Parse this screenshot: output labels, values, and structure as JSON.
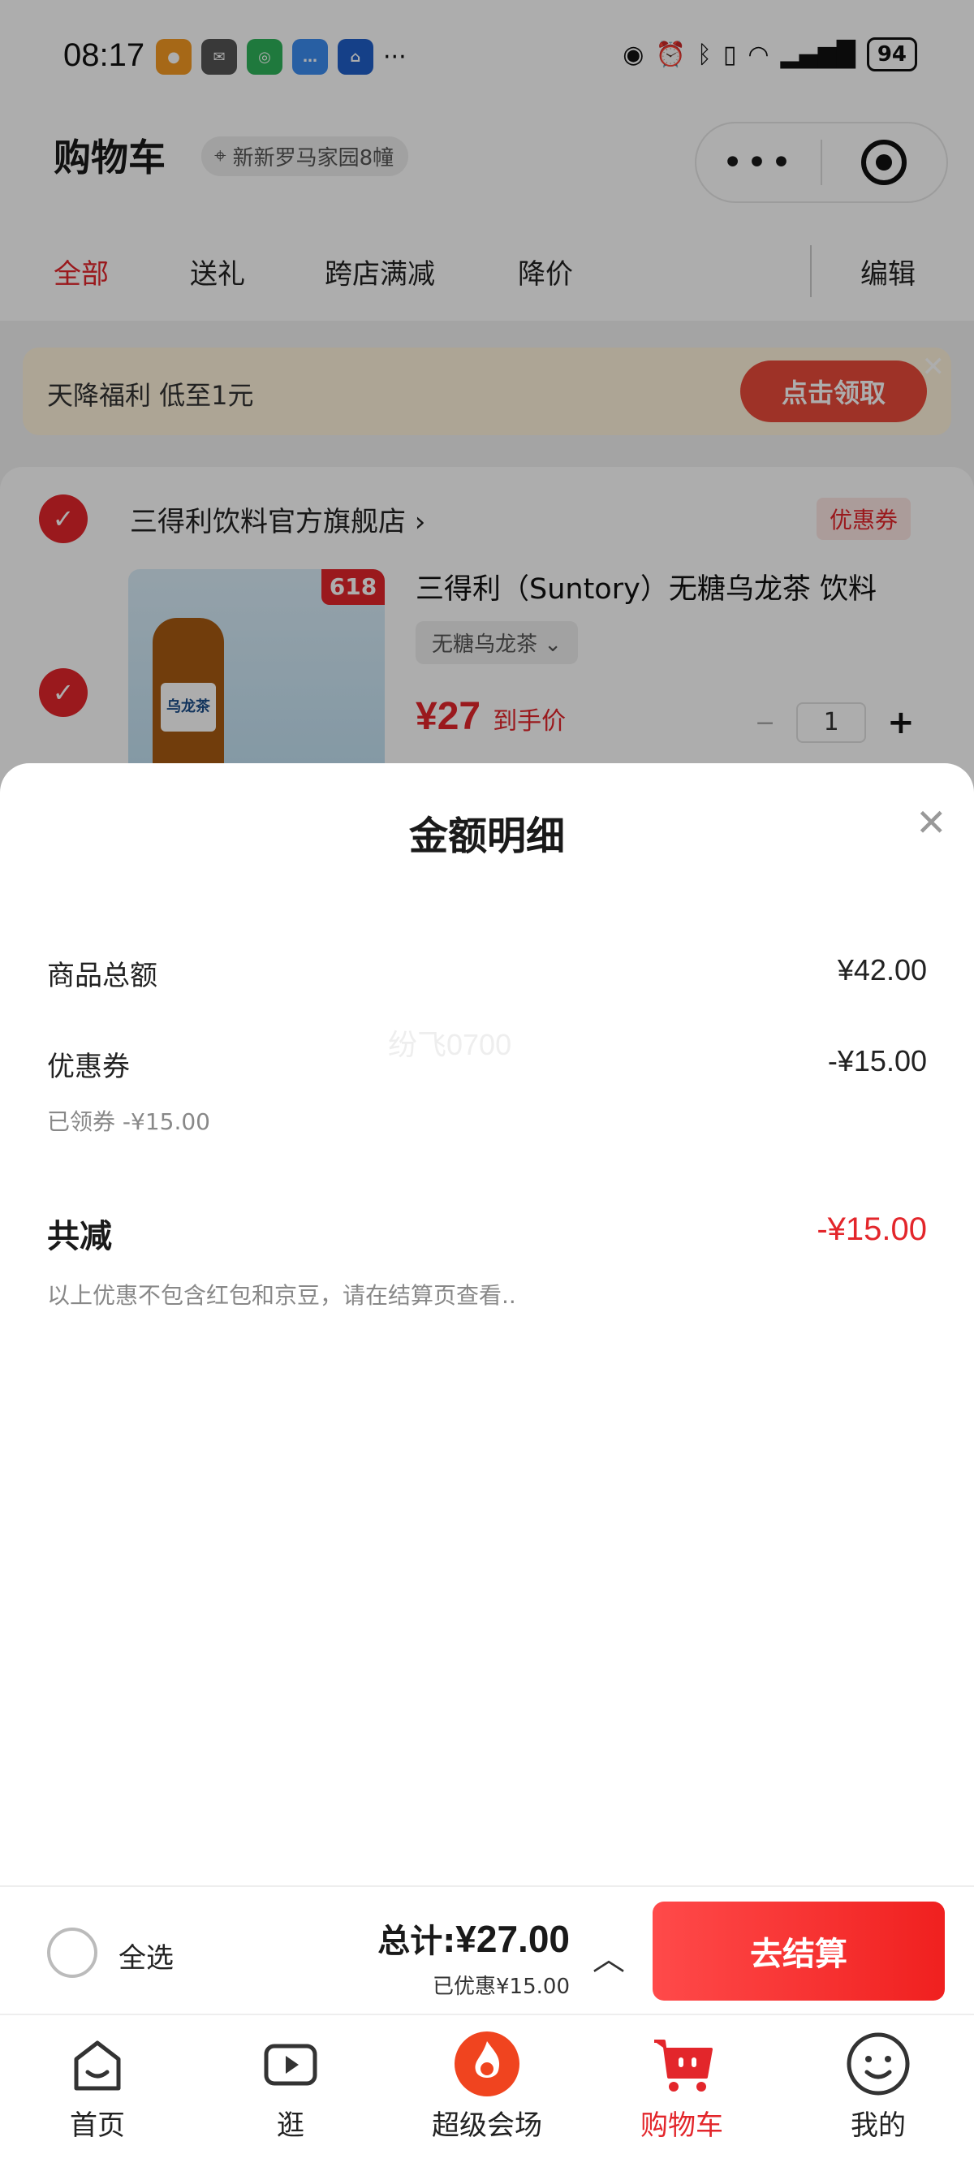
{
  "status_bar": {
    "time": "08:17",
    "battery": "94"
  },
  "header": {
    "title": "购物车",
    "location": "新新罗马家园8幢"
  },
  "tabs": [
    "全部",
    "送礼",
    "跨店满减",
    "降价"
  ],
  "edit_label": "编辑",
  "banner": {
    "text": "天降福利 低至1元",
    "button": "点击领取"
  },
  "store": {
    "name": "三得利饮料官方旗舰店 ›",
    "coupon_tag": "优惠券",
    "product": {
      "title": "三得利（Suntory）无糖乌龙茶 饮料",
      "badge": "618",
      "bottle_label": "乌龙茶",
      "variant": "无糖乌龙茶 ⌄",
      "price": "¥27",
      "price_note": "到手价",
      "quantity": "1"
    }
  },
  "sheet": {
    "title": "金额明细",
    "watermark": "纷飞0700",
    "rows": [
      {
        "label": "商品总额",
        "value": "¥42.00"
      },
      {
        "label": "优惠券",
        "value": "-¥15.00",
        "sub": "已领券 -¥15.00"
      }
    ],
    "total_label": "共减",
    "total_value": "-¥15.00",
    "note": "以上优惠不包含红包和京豆，请在结算页查看.."
  },
  "checkout": {
    "select_all": "全选",
    "total_label": "总计:",
    "total_amount": "¥27.00",
    "saved": "已优惠¥15.00",
    "button": "去结算"
  },
  "bottom_nav": [
    {
      "label": "首页",
      "icon": "home-icon"
    },
    {
      "label": "逛",
      "icon": "video-icon"
    },
    {
      "label": "超级会场",
      "icon": "super-venue-icon"
    },
    {
      "label": "购物车",
      "icon": "cart-icon"
    },
    {
      "label": "我的",
      "icon": "profile-icon"
    }
  ],
  "colors": {
    "accent": "#e3262b",
    "checkout_button": "#f0201f"
  }
}
